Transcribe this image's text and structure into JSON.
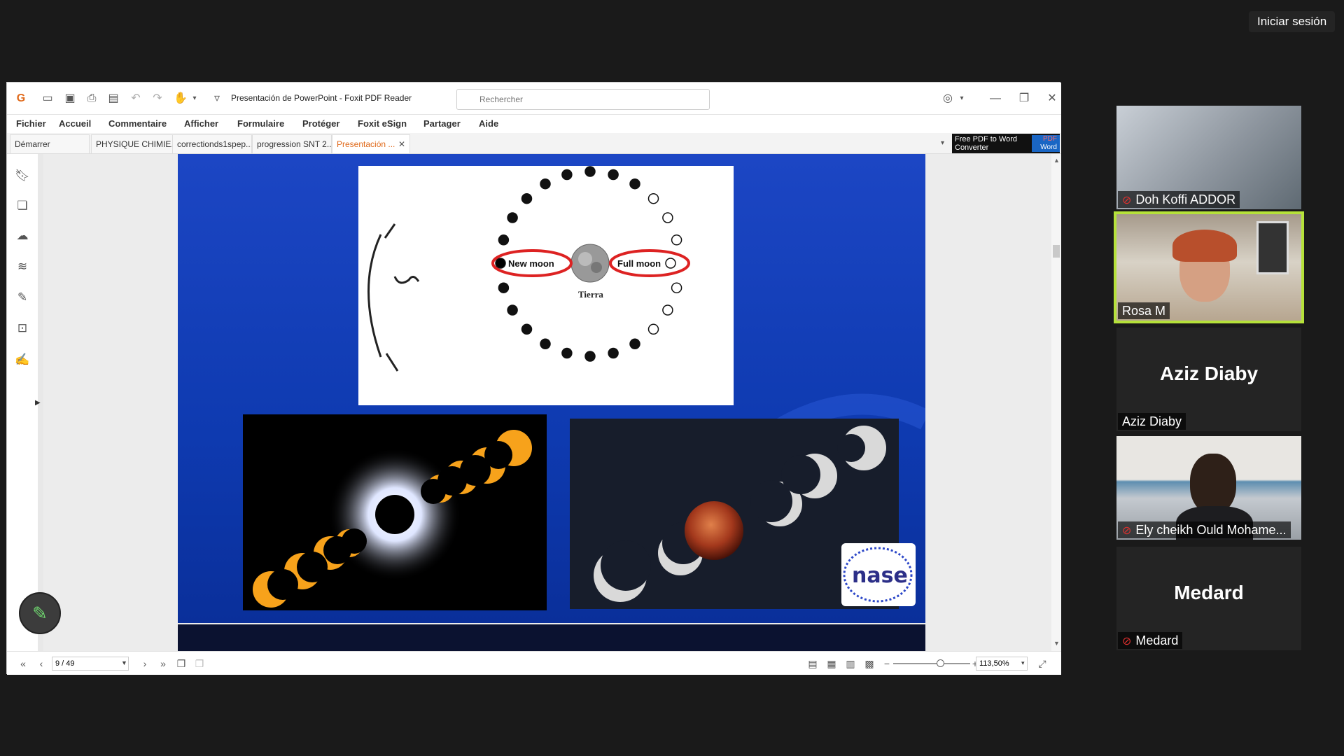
{
  "top": {
    "signin_label": "Iniciar sesión"
  },
  "window": {
    "title": "Presentación de PowerPoint - Foxit PDF Reader",
    "search_placeholder": "Rechercher"
  },
  "menu": [
    "Fichier",
    "Accueil",
    "Commentaire",
    "Afficher",
    "Formulaire",
    "Protéger",
    "Foxit eSign",
    "Partager",
    "Aide"
  ],
  "tabs": [
    {
      "label": "Démarrer"
    },
    {
      "label": "PHYSIQUE CHIMIE..."
    },
    {
      "label": "correctionds1spep..."
    },
    {
      "label": "progression SNT 2..."
    },
    {
      "label": "Presentación ...",
      "active": true
    }
  ],
  "promo": {
    "line1": "Free PDF to Word",
    "line2": "Converter",
    "badge1": "PDF",
    "badge2": "Word"
  },
  "slide": {
    "labels": {
      "new_moon": "New moon",
      "full_moon": "Full moon",
      "earth": "Tierra",
      "logo": "nase"
    }
  },
  "status": {
    "page": "9 / 49",
    "zoom": "113,50%"
  },
  "participants": [
    {
      "name": "Doh Koffi ADDOR",
      "muted": true,
      "video": true
    },
    {
      "name": "Rosa M",
      "muted": false,
      "video": true,
      "speaking": true
    },
    {
      "name": "Aziz Diaby",
      "muted": false,
      "video": false
    },
    {
      "name": "Ely cheikh Ould Mohame...",
      "muted": true,
      "video": true
    },
    {
      "name": "Medard",
      "muted": true,
      "video": false
    }
  ],
  "colors": {
    "accent": "#e06a1b",
    "speaking_border": "#b6e23a",
    "slide_blue": "#1340b8",
    "mute_red": "#e0302e"
  }
}
